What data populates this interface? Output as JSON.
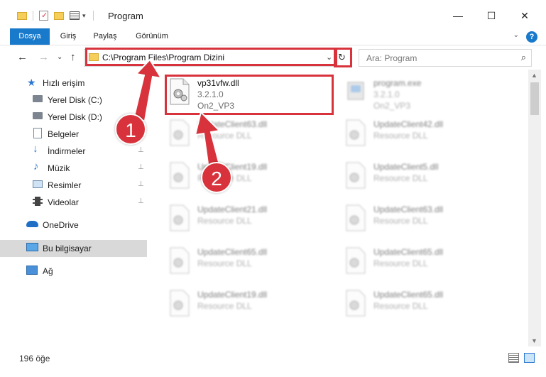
{
  "window": {
    "title": "Program",
    "minimize": "—",
    "maximize": "☐",
    "close": "✕"
  },
  "ribbon": {
    "tabs": [
      "Dosya",
      "Giriş",
      "Paylaş",
      "Görünüm"
    ],
    "help": "?"
  },
  "nav": {
    "back": "←",
    "forward": "→",
    "recent": "⌄",
    "up": "↑",
    "address": "C:\\Program Files\\Program Dizini",
    "refresh": "↻",
    "search_placeholder": "Ara: Program",
    "search_icon": "⌕"
  },
  "sidebar": {
    "items": [
      {
        "label": "Hızlı erişim",
        "icon": "star-icon"
      },
      {
        "label": "Yerel Disk (C:)",
        "icon": "drive-icon"
      },
      {
        "label": "Yerel Disk (D:)",
        "icon": "drive-icon"
      },
      {
        "label": "Belgeler",
        "icon": "documents-icon"
      },
      {
        "label": "İndirmeler",
        "icon": "download-icon"
      },
      {
        "label": "Müzik",
        "icon": "music-icon"
      },
      {
        "label": "Resimler",
        "icon": "pictures-icon"
      },
      {
        "label": "Videolar",
        "icon": "videos-icon"
      },
      {
        "label": "OneDrive",
        "icon": "cloud-icon"
      },
      {
        "label": "Bu bilgisayar",
        "icon": "computer-icon"
      },
      {
        "label": "Ağ",
        "icon": "network-icon"
      }
    ],
    "pin": "📌"
  },
  "files": [
    {
      "name": "vp31vfw.dll",
      "line1": "3.2.1.0",
      "line2": "On2_VP3"
    },
    {
      "name": "program.exe",
      "line1": "3.2.1.0",
      "line2": "On2_VP3"
    },
    {
      "name": "UpdateClient63.dll",
      "line1": "Resource DLL",
      "line2": ""
    },
    {
      "name": "UpdateClient42.dll",
      "line1": "Resource DLL",
      "line2": ""
    },
    {
      "name": "UpdateClient19.dll",
      "line1": "Resource DLL",
      "line2": ""
    },
    {
      "name": "UpdateClient5.dll",
      "line1": "Resource DLL",
      "line2": ""
    },
    {
      "name": "UpdateClient21.dll",
      "line1": "Resource DLL",
      "line2": ""
    },
    {
      "name": "UpdateClient63.dll",
      "line1": "Resource DLL",
      "line2": ""
    },
    {
      "name": "UpdateClient65.dll",
      "line1": "Resource DLL",
      "line2": ""
    },
    {
      "name": "UpdateClient65.dll",
      "line1": "Resource DLL",
      "line2": ""
    },
    {
      "name": "UpdateClient19.dll",
      "line1": "Resource DLL",
      "line2": ""
    },
    {
      "name": "UpdateClient65.dll",
      "line1": "Resource DLL",
      "line2": ""
    }
  ],
  "status": {
    "count": "196 öğe"
  },
  "callouts": [
    "1",
    "2"
  ],
  "colors": {
    "accent": "#1979ca",
    "highlight": "#d8333c",
    "selected": "#d9d9d9"
  }
}
